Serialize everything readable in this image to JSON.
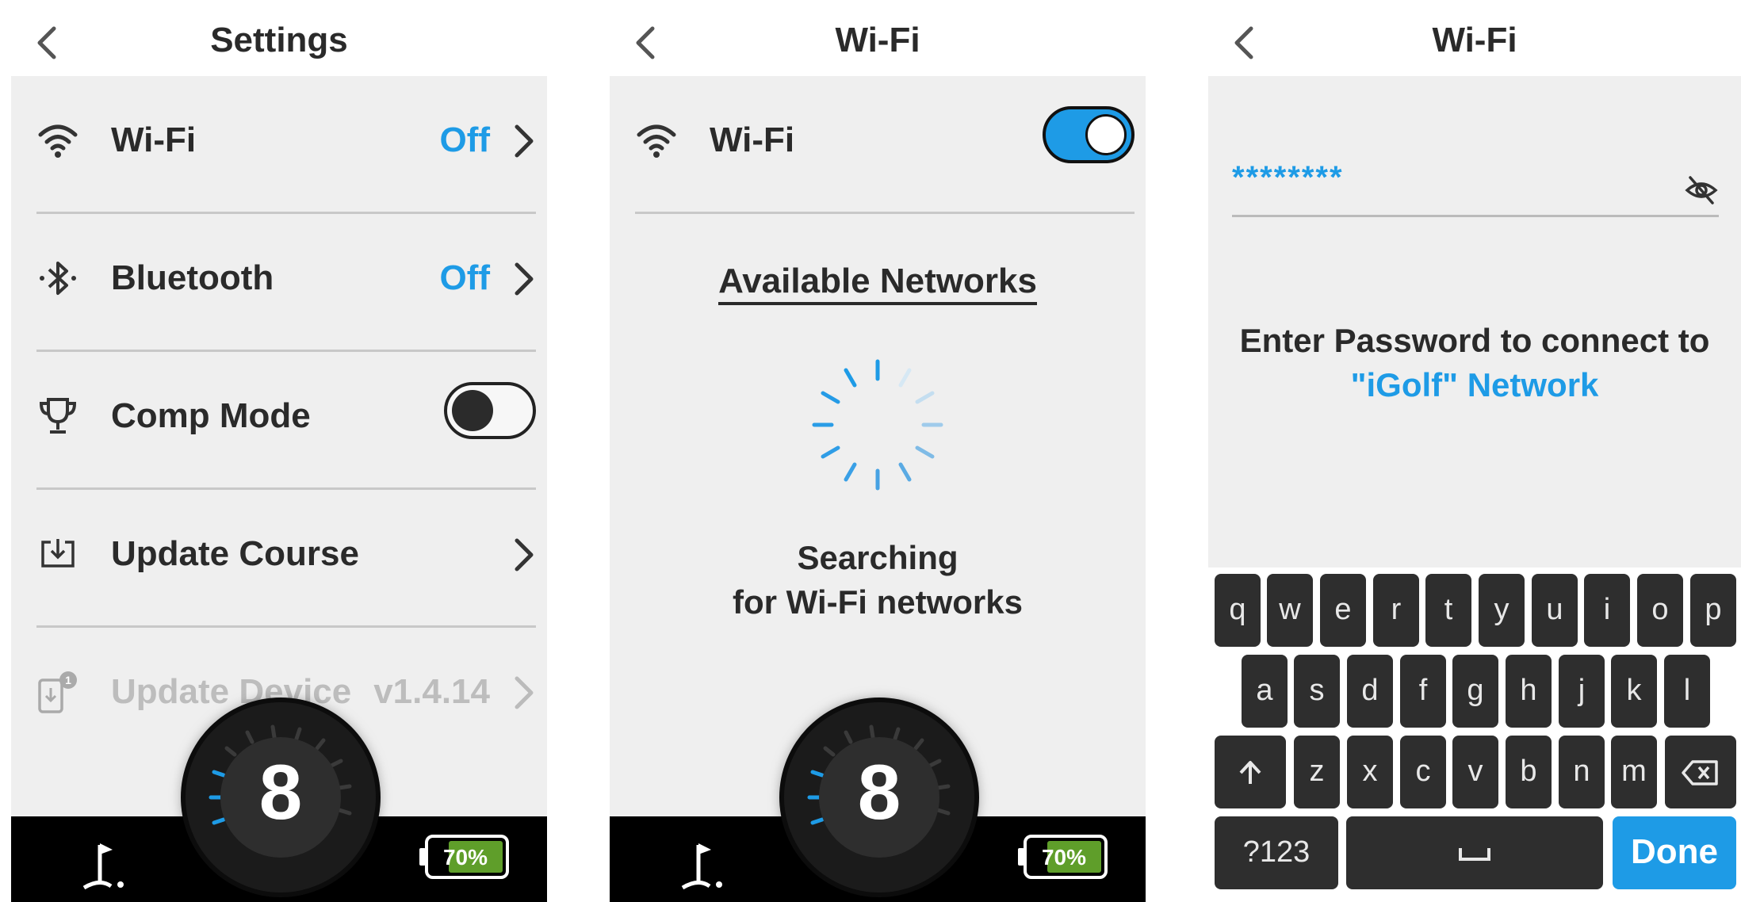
{
  "screen1": {
    "title": "Settings",
    "rows": [
      {
        "label": "Wi-Fi",
        "value": "Off",
        "icon": "wifi-icon"
      },
      {
        "label": "Bluetooth",
        "value": "Off",
        "icon": "bluetooth-icon"
      },
      {
        "label": "Comp Mode",
        "toggle": "off",
        "icon": "trophy-icon"
      },
      {
        "label": "Update Course",
        "icon": "download-icon"
      },
      {
        "label": "Update Device",
        "value": "v1.4.14",
        "badge": "1",
        "icon": "device-update-icon"
      }
    ],
    "hole": "8",
    "battery": "70%"
  },
  "screen2": {
    "title": "Wi-Fi",
    "wifi_label": "Wi-Fi",
    "wifi_toggle": "on",
    "section": "Available Networks",
    "search_line1": "Searching",
    "search_line2": "for Wi-Fi networks",
    "hole": "8",
    "battery": "70%"
  },
  "screen3": {
    "title": "Wi-Fi",
    "password": "********",
    "prompt_line1": "Enter Password to connect to",
    "prompt_line2": "\"iGolf\" Network",
    "keyboard": {
      "row1": [
        "q",
        "w",
        "e",
        "r",
        "t",
        "y",
        "u",
        "i",
        "o",
        "p"
      ],
      "row2": [
        "a",
        "s",
        "d",
        "f",
        "g",
        "h",
        "j",
        "k",
        "l"
      ],
      "row3": [
        "z",
        "x",
        "c",
        "v",
        "b",
        "n",
        "m"
      ],
      "numbers": "?123",
      "done": "Done"
    }
  },
  "colors": {
    "accent": "#1e9be6",
    "panel": "#efefef",
    "bar": "#000000",
    "battery_fill": "#5f9e2a"
  }
}
